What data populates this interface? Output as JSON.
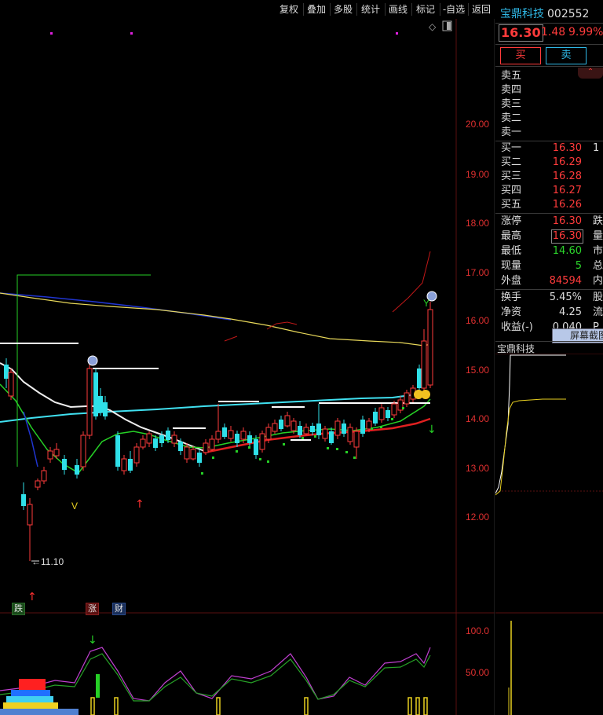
{
  "toolbar": {
    "items": [
      "复权",
      "叠加",
      "多股",
      "统计",
      "画线",
      "标记",
      "-自选",
      "返回"
    ]
  },
  "chart": {
    "price_axis": [
      "20.00",
      "19.00",
      "18.00",
      "17.00",
      "16.00",
      "15.00",
      "14.00",
      "13.00",
      "12.00"
    ],
    "low_marker": "11.10",
    "badges": {
      "die": "跌",
      "zhang": "涨",
      "cai": "财"
    },
    "v_marker": "V",
    "y_marker": "Y",
    "sub_axis": [
      "100.0",
      "50.00"
    ]
  },
  "quote": {
    "name": "宝鼎科技",
    "code": "002552",
    "price": "16.30",
    "change": "1.48",
    "change_pct": "9.99%",
    "buy_label": "买",
    "sell_label": "卖",
    "sell_levels": [
      {
        "label": "卖五"
      },
      {
        "label": "卖四"
      },
      {
        "label": "卖三"
      },
      {
        "label": "卖二"
      },
      {
        "label": "卖一"
      }
    ],
    "buy_levels": [
      {
        "label": "买一",
        "price": "16.30",
        "extra": "1"
      },
      {
        "label": "买二",
        "price": "16.29"
      },
      {
        "label": "买三",
        "price": "16.28"
      },
      {
        "label": "买四",
        "price": "16.27"
      },
      {
        "label": "买五",
        "price": "16.26"
      }
    ],
    "stats": [
      {
        "label": "涨停",
        "value": "16.30",
        "color": "red",
        "extra": "跌"
      },
      {
        "label": "最高",
        "value": "16.30",
        "color": "red",
        "extra": "量",
        "boxed": true
      },
      {
        "label": "最低",
        "value": "14.60",
        "color": "green",
        "extra": "市"
      },
      {
        "label": "现量",
        "value": "5",
        "color": "green",
        "extra": "总"
      },
      {
        "label": "外盘",
        "value": "84594",
        "color": "red",
        "extra": "内"
      }
    ],
    "stats2": [
      {
        "label": "换手",
        "value": "5.45%",
        "extra": "股"
      },
      {
        "label": "净资",
        "value": "4.25",
        "extra": "流"
      },
      {
        "label": "收益(-)",
        "value": "0.040",
        "extra": "P"
      }
    ],
    "screenshot_tip": "屏幕截图",
    "mini_title": "宝鼎科技"
  },
  "colors": {
    "up": "#ff3b3b",
    "down": "#2fe0e8",
    "accent": "#2fb8e6"
  }
}
